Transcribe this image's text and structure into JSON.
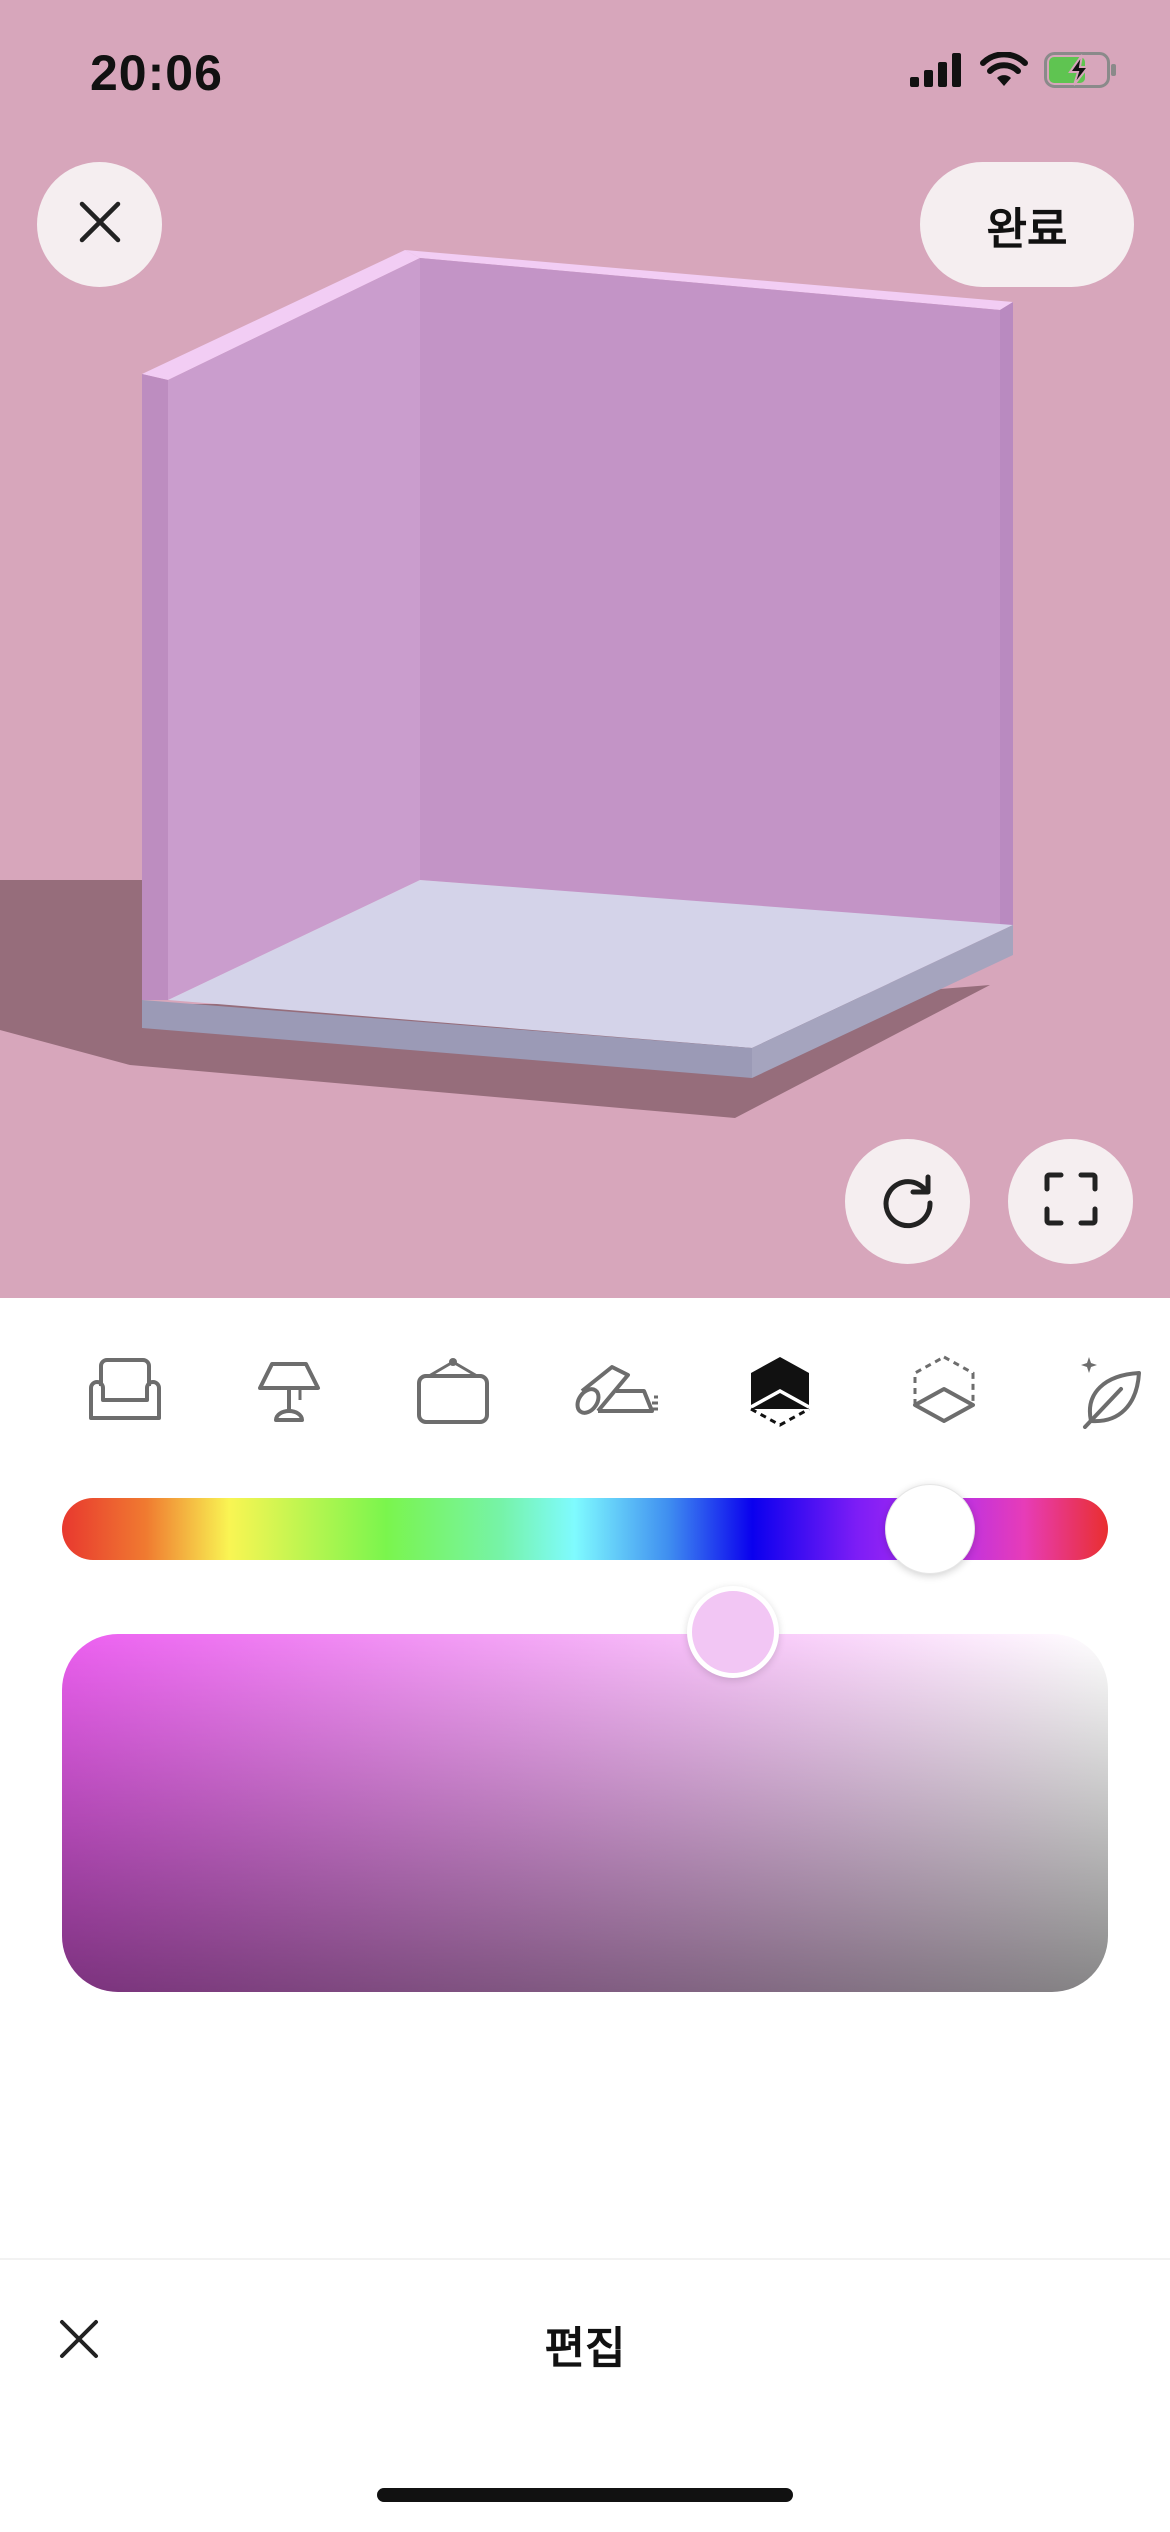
{
  "status_bar": {
    "time": "20:06",
    "icons": [
      "cellular-signal-icon",
      "wifi-icon",
      "battery-charging-icon"
    ]
  },
  "top_bar": {
    "close_icon": "close-icon",
    "done_label": "완료"
  },
  "viewer_controls": {
    "rotate_icon": "rotate-icon",
    "fullscreen_icon": "fullscreen-icon"
  },
  "categories": [
    {
      "name": "furniture",
      "icon": "sofa-icon",
      "selected": false
    },
    {
      "name": "lighting",
      "icon": "lamp-icon",
      "selected": false
    },
    {
      "name": "wall-decor",
      "icon": "frame-icon",
      "selected": false
    },
    {
      "name": "rug",
      "icon": "rug-icon",
      "selected": false
    },
    {
      "name": "wall",
      "icon": "wall-color-icon",
      "selected": true
    },
    {
      "name": "floor",
      "icon": "floor-icon",
      "selected": false
    },
    {
      "name": "plant",
      "icon": "leaf-icon",
      "selected": false
    }
  ],
  "color_picker": {
    "hue_position": 0.83,
    "selected_color": "#f2c6f4",
    "saturation": 0.64,
    "brightness": 1.0
  },
  "colors": {
    "background": "#d7a6bb",
    "wall": "#c594c6",
    "floor": "#d4d3e9",
    "button_bg": "#f5eef0"
  },
  "footer": {
    "close_icon": "close-icon",
    "title": "편집"
  }
}
